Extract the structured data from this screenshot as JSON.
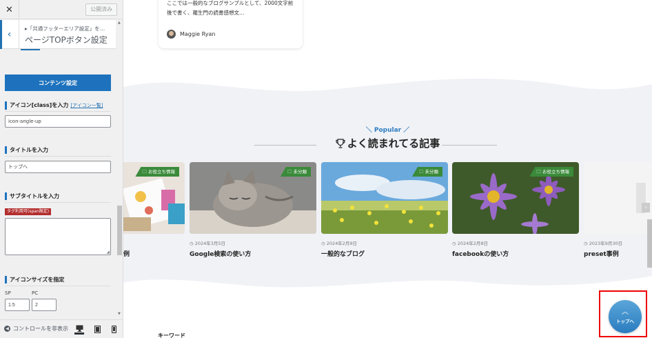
{
  "sidebar": {
    "close_icon": "close-icon",
    "published_label": "公開済み",
    "breadcrumb": "▸「共通フッターエリア設定」を…",
    "panel_title": "ページTOPボタン設定",
    "content_settings_label": "コンテンツ設定",
    "icon_class_label": "アイコン[class]を入力",
    "icon_list_link": "[アイコン一覧]",
    "icon_class_value": "icon-angle-up",
    "title_label": "タイトルを入力",
    "title_value": "トップへ",
    "subtitle_label": "サブタイトルを入力",
    "tag_badge": "タグ利用可(span限定)",
    "icon_size_label": "アイコンサイズを指定",
    "sp_label": "SP",
    "pc_label": "PC",
    "sp_value": "1.5",
    "pc_value": "2",
    "hide_controls_label": "コントロールを非表示",
    "devices": [
      "desktop-icon",
      "tablet-icon",
      "mobile-icon"
    ],
    "accent_color": "#2271b1"
  },
  "preview": {
    "excerpt": "ここでは一般的なブログサンプルとして、2000文字前後で書く、羅生門の読書感想文…",
    "author": "Maggie Ryan",
    "popular_en": "＼ Popular ／",
    "popular_title": "よく読まれてる記事",
    "cards": [
      {
        "category": "お役立ち情報",
        "date": "",
        "title": "例"
      },
      {
        "category": "未分類",
        "date": "◷ 2024年3月5日",
        "title": "Google検索の使い方"
      },
      {
        "category": "未分類",
        "date": "◷ 2024年2月9日",
        "title": "一般的なブログ"
      },
      {
        "category": "お役立ち情報",
        "date": "◷ 2024年2月8日",
        "title": "facebookの使い方"
      },
      {
        "category": "",
        "date": "◷ 2023年9月30日",
        "title": "preset事例"
      }
    ],
    "keyword_heading": "キーワード",
    "top_button": {
      "icon": "chevron-up-icon",
      "label": "トップへ",
      "color": "#2b7cbf"
    },
    "highlight_color": "#ee0000",
    "category_color": "#3a8a3a"
  }
}
